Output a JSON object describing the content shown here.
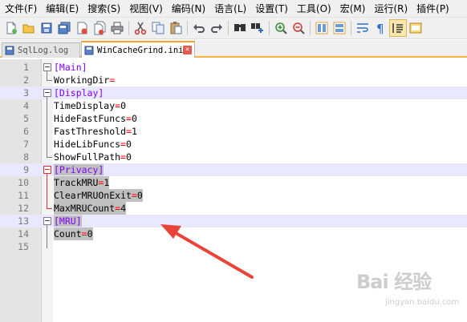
{
  "menu": [
    "文件(F)",
    "编辑(E)",
    "搜索(S)",
    "视图(V)",
    "编码(N)",
    "语言(L)",
    "设置(T)",
    "工具(O)",
    "宏(M)",
    "运行(R)",
    "插件(P)"
  ],
  "toolbar": {
    "buttons": [
      "new-file-icon",
      "open-file-icon",
      "save-icon",
      "save-all-icon",
      "close-icon",
      "close-all-icon",
      "print-icon",
      "cut-icon",
      "copy-icon",
      "paste-icon",
      "undo-icon",
      "redo-icon",
      "find-icon",
      "replace-icon",
      "zoom-in-icon",
      "zoom-out-icon",
      "sync-vertical-icon",
      "sync-horizontal-icon",
      "word-wrap-icon",
      "show-all-chars-icon",
      "indent-guide-icon",
      "user-lang-icon"
    ]
  },
  "tabs": [
    {
      "label": "SqlLog.log",
      "active": false
    },
    {
      "label": "WinCacheGrind.ini",
      "active": true
    }
  ],
  "editor": {
    "lines": [
      {
        "n": "1",
        "section": "[Main]",
        "key": "",
        "value": ""
      },
      {
        "n": "2",
        "section": "",
        "key": "WorkingDir",
        "value": ""
      },
      {
        "n": "3",
        "section": "[Display]",
        "key": "",
        "value": ""
      },
      {
        "n": "4",
        "section": "",
        "key": "TimeDisplay",
        "value": "0"
      },
      {
        "n": "5",
        "section": "",
        "key": "HideFastFuncs",
        "value": "0"
      },
      {
        "n": "6",
        "section": "",
        "key": "FastThreshold",
        "value": "1"
      },
      {
        "n": "7",
        "section": "",
        "key": "HideLibFuncs",
        "value": "0"
      },
      {
        "n": "8",
        "section": "",
        "key": "ShowFullPath",
        "value": "0"
      },
      {
        "n": "9",
        "section": "[Privacy]",
        "key": "",
        "value": ""
      },
      {
        "n": "10",
        "section": "",
        "key": "TrackMRU",
        "value": "1"
      },
      {
        "n": "11",
        "section": "",
        "key": "ClearMRUOnExit",
        "value": "0"
      },
      {
        "n": "12",
        "section": "",
        "key": "MaxMRUCount",
        "value": "4"
      },
      {
        "n": "13",
        "section": "[MRU]",
        "key": "",
        "value": ""
      },
      {
        "n": "14",
        "section": "",
        "key": "Count",
        "value": "0"
      },
      {
        "n": "15",
        "section": "",
        "key": "",
        "value": ""
      }
    ],
    "eq": "="
  },
  "watermark": {
    "main": "Bai 经验",
    "sub": "jingyan.baidu.com"
  },
  "colors": {
    "section": "#8000ff",
    "equals": "#ff0000",
    "selection": "#c0c0c0",
    "current_line": "#e8e8ff",
    "arrow": "#e8443a",
    "tab_accent": "#f6a12b"
  }
}
